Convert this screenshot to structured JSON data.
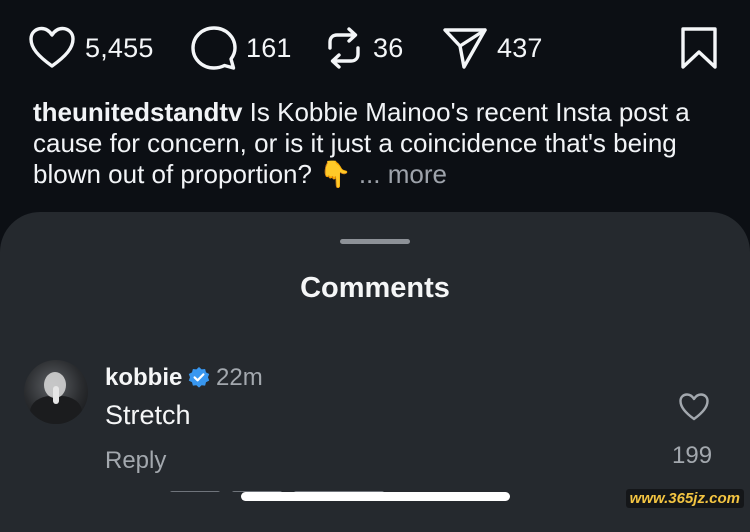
{
  "actions": {
    "likes": "5,455",
    "comments": "161",
    "reposts": "36",
    "shares": "437"
  },
  "caption": {
    "username": "theunitedstandtv",
    "text": " Is Kobbie Mainoo's recent Insta post a cause for concern, or is it just a coincidence that's being blown out of proportion? ",
    "emoji": "👇",
    "more": "... more"
  },
  "sheet": {
    "title": "Comments"
  },
  "comment": {
    "username": "kobbie",
    "verified": true,
    "time": "22m",
    "text": "Stretch",
    "reply_label": "Reply",
    "like_count": "199"
  },
  "watermark": "www.365jz.com",
  "colors": {
    "background": "#0c0f14",
    "sheet": "#25292e",
    "verified_blue": "#3897f0",
    "muted_text": "#a3a8ae"
  },
  "icons": {
    "like": "heart-icon",
    "comment": "speech-bubble-icon",
    "repost": "repost-arrows-icon",
    "share": "paper-plane-icon",
    "save": "bookmark-icon",
    "verified": "verified-badge-icon",
    "comment_like": "heart-outline-icon"
  }
}
